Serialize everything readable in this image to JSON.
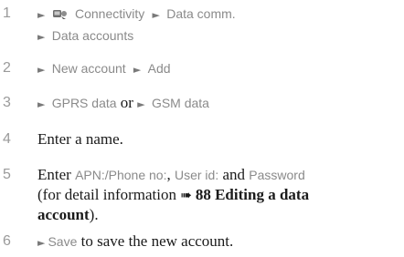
{
  "steps": [
    {
      "number": "1",
      "line1": {
        "item1": "Connectivity",
        "item2": "Data comm."
      },
      "line2": {
        "item1": "Data accounts"
      }
    },
    {
      "number": "2",
      "item1": "New account",
      "item2": "Add"
    },
    {
      "number": "3",
      "item1": "GPRS data",
      "connector": "or",
      "item2": "GSM data"
    },
    {
      "number": "4",
      "text": "Enter a name."
    },
    {
      "number": "5",
      "t1": "Enter ",
      "apn": "APN:/Phone no:",
      "t2": ", ",
      "userid": "User id:",
      "t3": " and ",
      "password": "Password",
      "t4": "(for detail information ",
      "ref": "88 Editing a data",
      "ref2": "account",
      "t5": ")."
    },
    {
      "number": "6",
      "save": "Save",
      "text": " to save the new account."
    }
  ],
  "icons": {
    "menu_arrow": "right-triangle-icon",
    "connectivity": "connectivity-icon",
    "reference": "hand-arrow-icon"
  }
}
